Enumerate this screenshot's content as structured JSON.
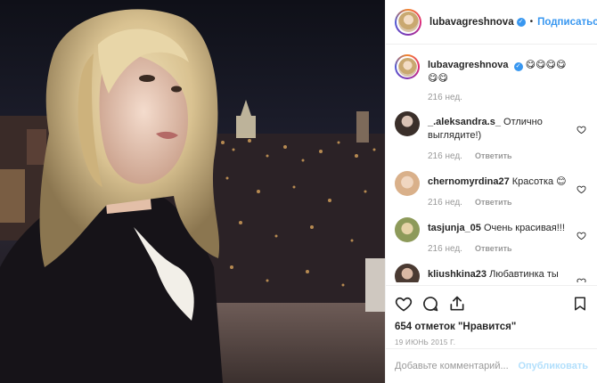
{
  "post": {
    "author": "lubavagreshnova",
    "follow_label": "Подписаться",
    "separator": "•",
    "more_label": "•••"
  },
  "caption": {
    "user": "lubavagreshnova",
    "text": "😋😋😋😋😋😋",
    "time": "216 нед."
  },
  "comments": [
    {
      "user": "_.aleksandra.s_",
      "text": "Отлично выглядите!)",
      "time": "216 нед.",
      "reply": "Ответить",
      "avatar_color": "#3a2f2a"
    },
    {
      "user": "chernomyrdina27",
      "text": "Красотка 😊",
      "time": "216 нед.",
      "reply": "Ответить",
      "avatar_color": "#d9b08a"
    },
    {
      "user": "tasjunja_05",
      "text": "Очень красивая!!!",
      "time": "216 нед.",
      "reply": "Ответить",
      "avatar_color": "#8d9a5a"
    },
    {
      "user": "kliushkina23",
      "text": "Любавтинка ты прелестна))))😉✌",
      "time": "",
      "reply": "",
      "avatar_color": "#4a3a32"
    }
  ],
  "actions": {
    "likes": "654 отметок \"Нравится\"",
    "date": "19 ИЮНЬ 2015 Г."
  },
  "comment_box": {
    "placeholder": "Добавьте комментарий...",
    "publish_label": "Опубликовать"
  },
  "colors": {
    "accent": "#3897f0",
    "publish_disabled": "#b2dffc",
    "muted": "#999999"
  }
}
